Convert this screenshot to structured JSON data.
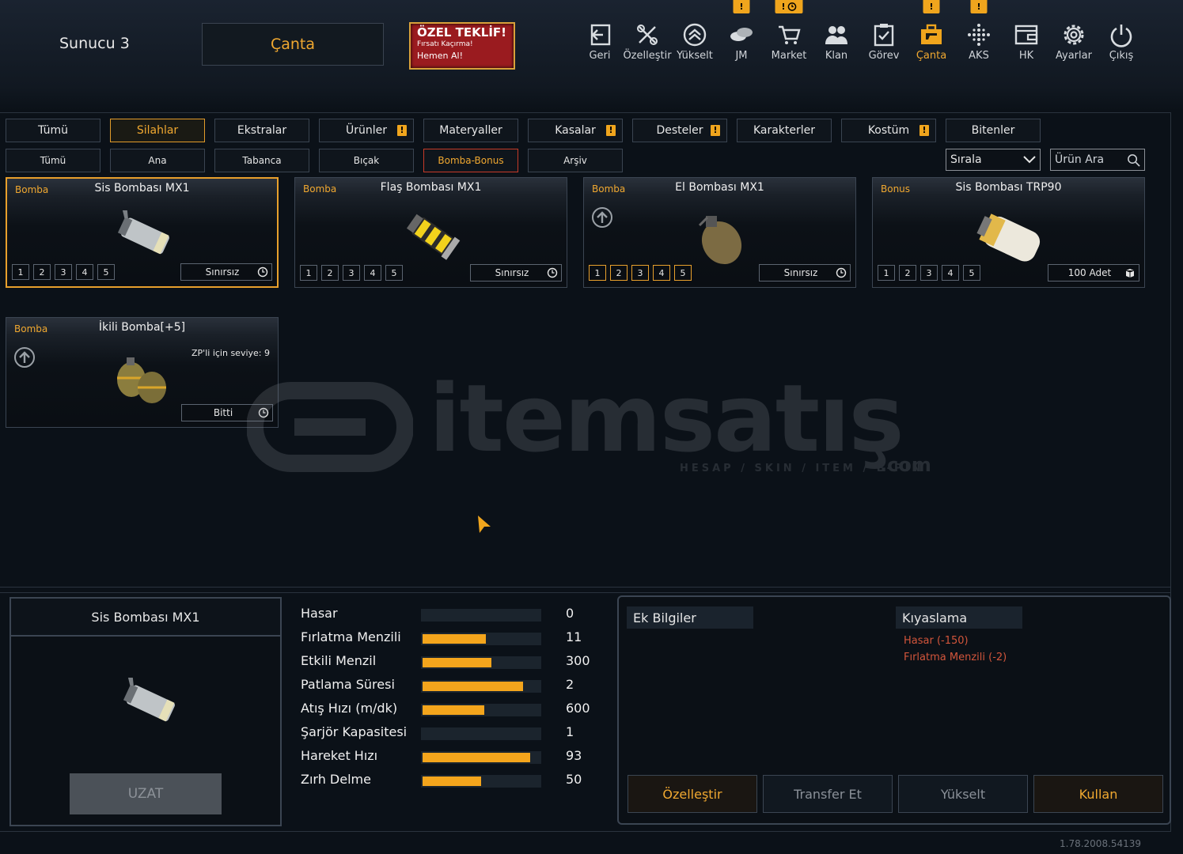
{
  "header": {
    "server": "Sunucu 3",
    "bag_title": "Çanta",
    "offer": {
      "line1": "ÖZEL TEKLİF!",
      "line2": "Fırsatı Kaçırma!",
      "line3": "Hemen Al!"
    }
  },
  "nav": [
    {
      "label": "Geri",
      "icon": "exit-icon"
    },
    {
      "label": "Özelleştir",
      "icon": "tools-icon"
    },
    {
      "label": "Yükselt",
      "icon": "upgrade-icon"
    },
    {
      "label": "JM",
      "icon": "coins-icon",
      "badge": "!"
    },
    {
      "label": "Market",
      "icon": "cart-icon",
      "badge": "!"
    },
    {
      "label": "Klan",
      "icon": "clan-icon"
    },
    {
      "label": "Görev",
      "icon": "task-icon"
    },
    {
      "label": "Çanta",
      "icon": "bag-icon",
      "badge": "!"
    },
    {
      "label": "AKS",
      "icon": "aks-icon",
      "badge": "!"
    },
    {
      "label": "HK",
      "icon": "wallet-icon"
    },
    {
      "label": "Ayarlar",
      "icon": "gear-icon"
    },
    {
      "label": "Çıkış",
      "icon": "power-icon"
    }
  ],
  "tabs": [
    {
      "label": "Tümü"
    },
    {
      "label": "Silahlar"
    },
    {
      "label": "Ekstralar"
    },
    {
      "label": "Ürünler",
      "warn": "!"
    },
    {
      "label": "Materyaller"
    },
    {
      "label": "Kasalar",
      "warn": "!"
    },
    {
      "label": "Desteler",
      "warn": "!"
    },
    {
      "label": "Karakterler"
    },
    {
      "label": "Kostüm",
      "warn": "!"
    },
    {
      "label": "Bitenler"
    }
  ],
  "subtabs": [
    "Tümü",
    "Ana",
    "Tabanca",
    "Bıçak",
    "Bomba-Bonus",
    "Arşiv"
  ],
  "sort_label": "Sırala",
  "search_placeholder": "Ürün Ara",
  "items": [
    {
      "category": "Bomba",
      "name": "Sis Bombası MX1",
      "levels": [
        "1",
        "2",
        "3",
        "4",
        "5"
      ],
      "duration": "Sınırsız"
    },
    {
      "category": "Bomba",
      "name": "Flaş Bombası MX1",
      "levels": [
        "1",
        "2",
        "3",
        "4",
        "5"
      ],
      "duration": "Sınırsız"
    },
    {
      "category": "Bomba",
      "name": "El Bombası MX1",
      "levels": [
        "1",
        "2",
        "3",
        "4",
        "5"
      ],
      "duration": "Sınırsız"
    },
    {
      "category": "Bonus",
      "name": "Sis Bombası TRP90",
      "levels": [
        "1",
        "2",
        "3",
        "4",
        "5"
      ],
      "duration": "100 Adet"
    },
    {
      "category": "Bomba",
      "name": "İkili Bomba[+5]",
      "requirement": "ZP'li için seviye: 9",
      "duration": "Bitti"
    }
  ],
  "watermark": {
    "brand": "itemsatış",
    "tagline": "HESAP / SKIN / ITEM / E-PIN",
    "suffix": ".com"
  },
  "preview": {
    "name": "Sis Bombası MX1",
    "button": "UZAT"
  },
  "stats": [
    {
      "name": "Hasar",
      "value": "0",
      "fill": 0
    },
    {
      "name": "Fırlatma Menzili",
      "value": "11",
      "fill": 0.54
    },
    {
      "name": "Etkili Menzil",
      "value": "300",
      "fill": 0.59
    },
    {
      "name": "Patlama Süresi",
      "value": "2",
      "fill": 0.86
    },
    {
      "name": "Atış Hızı (m/dk)",
      "value": "600",
      "fill": 0.53
    },
    {
      "name": "Şarjör Kapasitesi",
      "value": "1",
      "fill": 0
    },
    {
      "name": "Hareket Hızı",
      "value": "93",
      "fill": 0.92
    },
    {
      "name": "Zırh Delme",
      "value": "50",
      "fill": 0.5
    }
  ],
  "info": {
    "extra_title": "Ek Bilgiler",
    "compare_title": "Kıyaslama",
    "compare_lines": [
      "Hasar (-150)",
      "Fırlatma Menzili (-2)"
    ]
  },
  "actions": [
    "Özelleştir",
    "Transfer Et",
    "Yükselt",
    "Kullan"
  ],
  "version": "1.78.2008.54139",
  "colors": {
    "accent": "#f0a830",
    "bar": "#f4a51c",
    "compare": "#d2553b",
    "offer": "#9a1b1f"
  }
}
